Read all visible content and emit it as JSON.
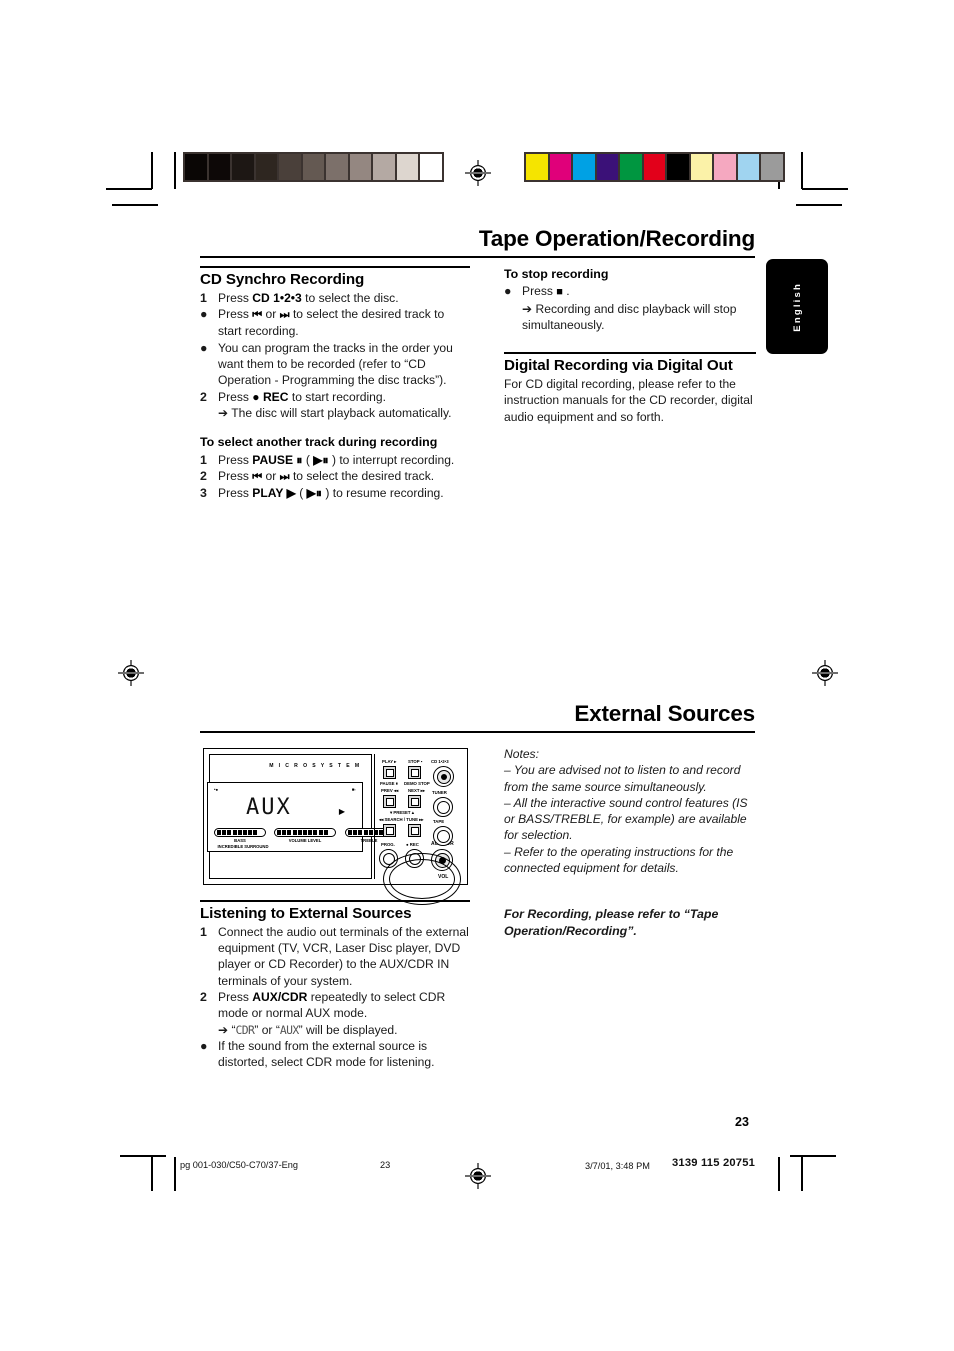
{
  "document": {
    "page_number": "23",
    "language_tab": "English"
  },
  "calibration": {
    "gray_bar": [
      "#0a0605",
      "#0d0807",
      "#1d1714",
      "#2e2620",
      "#4a403a",
      "#645952",
      "#7c706a",
      "#948781",
      "#b4a9a3",
      "#ddd6cf",
      "#ffffff"
    ],
    "color_bar": [
      "#f5e400",
      "#e0007a",
      "#00a1e4",
      "#3b1178",
      "#009640",
      "#e2001a",
      "#000000",
      "#fbf2a8",
      "#f5a8c0",
      "#a0d4f0",
      "#9b9b9b"
    ]
  },
  "chapter1": {
    "title": "Tape Operation/Recording",
    "left_column": {
      "heading": "CD Synchro Recording",
      "steps": [
        {
          "marker": "1",
          "marker_type": "number",
          "parts": [
            {
              "t": "Press "
            },
            {
              "t": "CD 1•2•3",
              "b": true
            },
            {
              "t": " to select the disc."
            }
          ]
        },
        {
          "marker": "●",
          "marker_type": "bullet",
          "parts": [
            {
              "t": "Press "
            },
            {
              "t": "⏮",
              "icon": true
            },
            {
              "t": " or "
            },
            {
              "t": "⏭",
              "icon": true
            },
            {
              "t": " to select the desired track to start recording."
            }
          ]
        },
        {
          "marker": "●",
          "marker_type": "bullet",
          "parts": [
            {
              "t": "You can program the tracks in the order you want them to be recorded (refer to “CD Operation - Programming the disc tracks”)."
            }
          ]
        },
        {
          "marker": "2",
          "marker_type": "number",
          "parts": [
            {
              "t": "Press "
            },
            {
              "t": "● REC",
              "b": true
            },
            {
              "t": " to start recording."
            }
          ],
          "arrow": "➔ The disc will start playback automatically."
        }
      ],
      "subheading": "To select another track during recording",
      "substeps": [
        {
          "marker": "1",
          "parts": [
            {
              "t": "Press "
            },
            {
              "t": "PAUSE ⏸",
              "b": true
            },
            {
              "t": " ( "
            },
            {
              "t": "▶⏸",
              "b": true
            },
            {
              "t": " ) to interrupt recording."
            }
          ]
        },
        {
          "marker": "2",
          "parts": [
            {
              "t": "Press "
            },
            {
              "t": "⏮",
              "icon": true
            },
            {
              "t": " or "
            },
            {
              "t": "⏭",
              "icon": true
            },
            {
              "t": " to select the desired track."
            }
          ]
        },
        {
          "marker": "3",
          "parts": [
            {
              "t": "Press "
            },
            {
              "t": "PLAY ▶",
              "b": true
            },
            {
              "t": " ( "
            },
            {
              "t": "▶⏸",
              "b": true
            },
            {
              "t": " ) to resume recording."
            }
          ]
        }
      ]
    },
    "right_column": {
      "subheading": "To stop recording",
      "stop_step": {
        "marker": "●",
        "parts": [
          {
            "t": "Press "
          },
          {
            "t": "■",
            "icon": true
          },
          {
            "t": " ."
          }
        ],
        "arrow": "➔ Recording and disc playback will stop simultaneously."
      },
      "heading2": "Digital Recording via Digital Out",
      "body2": "For CD digital recording, please refer to the instruction manuals for the CD recorder, digital audio equipment and so forth."
    }
  },
  "chapter2": {
    "title": "External Sources",
    "left_column": {
      "heading": "Listening to External Sources",
      "steps": [
        {
          "marker": "1",
          "marker_type": "number",
          "parts": [
            {
              "t": "Connect the audio out terminals of the external equipment (TV, VCR, Laser Disc player, DVD player or CD Recorder) to the AUX/CDR IN terminals of your system."
            }
          ]
        },
        {
          "marker": "2",
          "marker_type": "number",
          "parts": [
            {
              "t": "Press "
            },
            {
              "t": "AUX/CDR",
              "b": true
            },
            {
              "t": " repeatedly to select CDR mode or normal AUX mode."
            }
          ],
          "arrow_parts": [
            {
              "t": "➔ “"
            },
            {
              "t": "CDR",
              "lcd": true
            },
            {
              "t": "” or “"
            },
            {
              "t": "AUX",
              "lcd": true
            },
            {
              "t": "” will be displayed."
            }
          ]
        },
        {
          "marker": "●",
          "marker_type": "bullet",
          "parts": [
            {
              "t": "If the sound from the external source is distorted, select CDR mode for listening."
            }
          ]
        }
      ]
    },
    "right_column": {
      "notes_title": "Notes:",
      "notes": [
        "–  You are advised not to listen to and record from the same source simultaneously.",
        "–  All the interactive sound control features (IS or BASS/TREBLE, for example) are available for selection.",
        "–  Refer to the operating instructions for the connected equipment for details."
      ],
      "reference": "For Recording, please refer to “Tape Operation/Recording”."
    }
  },
  "device_illustration": {
    "brand_text": "M I C R O   S Y S T E M",
    "display": {
      "text": "AUX",
      "top_left_indicator": "•●",
      "top_right_indicator": "■▫",
      "play_indicator": "▶",
      "meters": [
        {
          "label": "BASS"
        },
        {
          "label": "VOLUME LEVEL"
        },
        {
          "label": "TREBLE"
        }
      ],
      "surround_label": "INCREDIBLE SURROUND"
    },
    "controls": {
      "row1": [
        {
          "label": "PLAY ▸",
          "sublabel": "PAUSE ⏸",
          "type": "square-button"
        },
        {
          "label": "STOP ▪",
          "sublabel": "DEMO STOP",
          "type": "square-button"
        }
      ],
      "row2": [
        {
          "label": "PREV ◂◂",
          "sublabel": "▾ PRESET ▴",
          "type": "square-button"
        },
        {
          "label": "NEXT ▸▸",
          "type": "square-button"
        }
      ],
      "row3_label": "◂◂ SEARCH / TUNE ▸▸",
      "row4": [
        {
          "label": "PROG.",
          "type": "knob"
        },
        {
          "label": "● REC",
          "type": "knob"
        },
        {
          "label": "AUX/CDR",
          "type": "knob",
          "highlighted": true
        }
      ],
      "source_knobs": [
        {
          "label": "CD 1•2•3"
        },
        {
          "label": "TUNER"
        },
        {
          "label": "TAPE"
        }
      ],
      "volume_label": "VOL"
    }
  },
  "footer": {
    "job": "pg 001-030/C50-C70/37-Eng",
    "page": "23",
    "timestamp": "3/7/01, 3:48 PM",
    "doc_id": "3139 115 20751"
  }
}
